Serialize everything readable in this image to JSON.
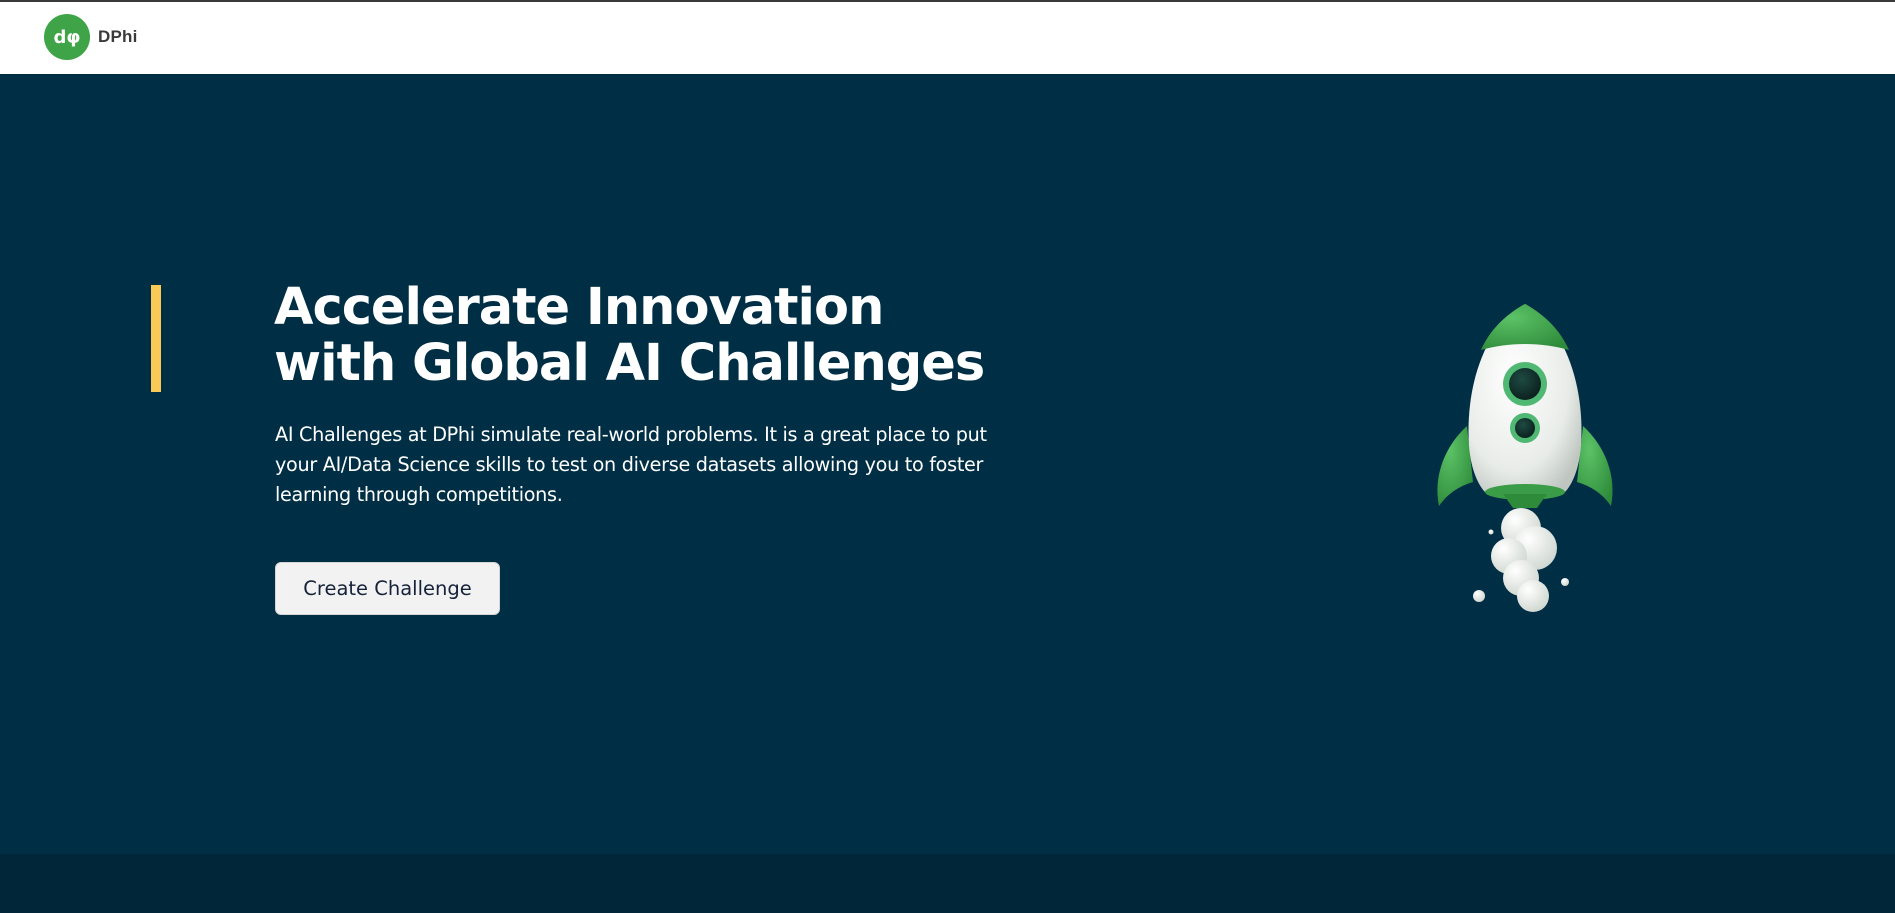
{
  "navbar": {
    "brand_name": "DPhi",
    "logo_text": "dφ"
  },
  "hero": {
    "title_line1": "Accelerate Innovation",
    "title_line2": "with Global AI Challenges",
    "description_line1": "AI Challenges at DPhi simulate real-world problems. It is a great place to put",
    "description_line2": "your AI/Data Science skills to test on diverse datasets allowing you to foster",
    "description_line3": "learning through competitions.",
    "cta_label": "Create Challenge",
    "illustration": "rocket-illustration"
  },
  "colors": {
    "hero_background": "#002f45",
    "accent": "#f9cb56",
    "brand_green": "#3fa447",
    "footer_band": "#012639"
  }
}
